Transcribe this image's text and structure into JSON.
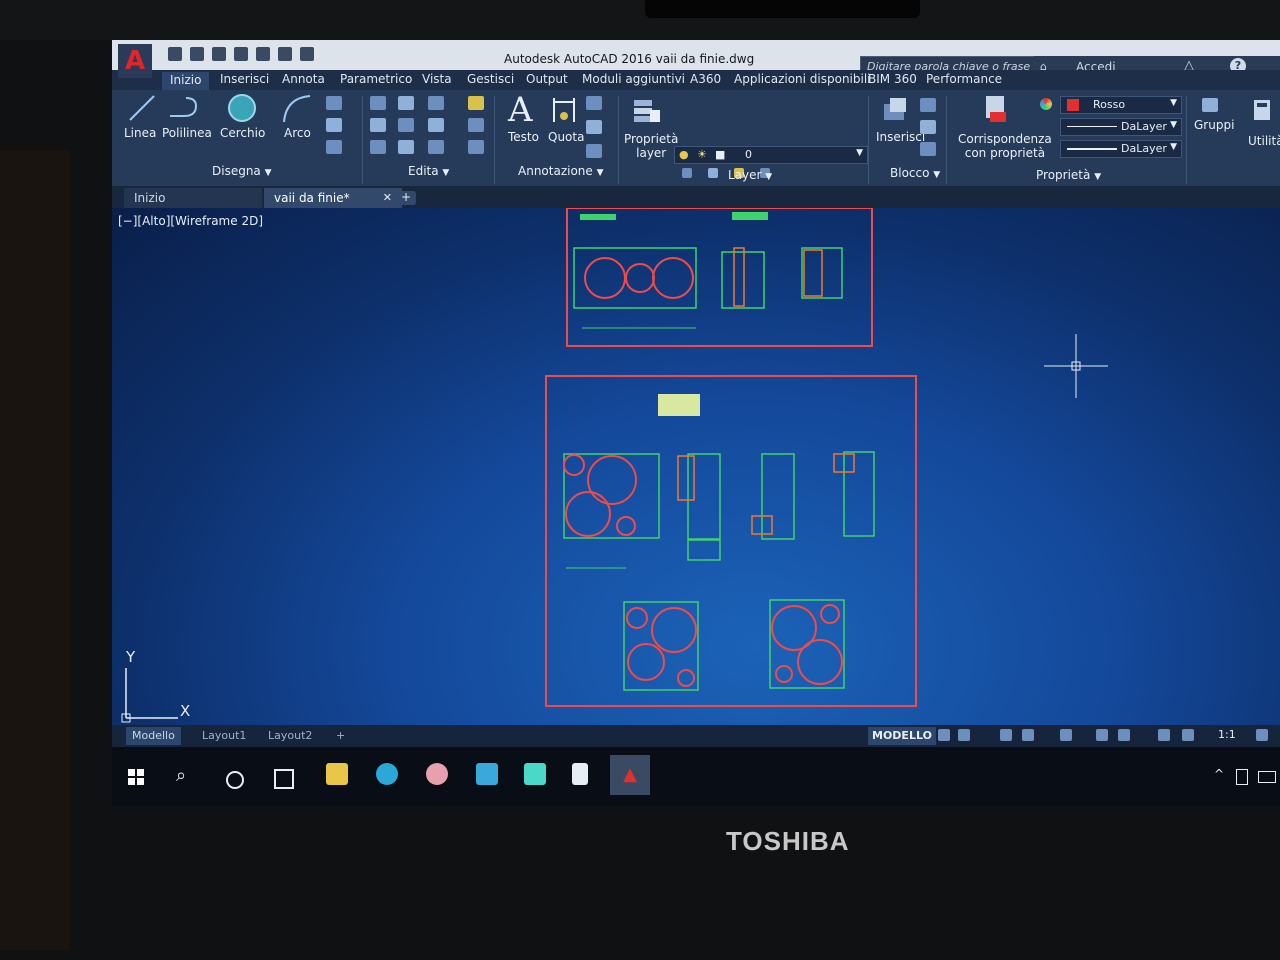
{
  "app": {
    "title": "Autodesk AutoCAD 2016    vaii da finie.dwg",
    "logo": "A"
  },
  "search": {
    "placeholder": "Digitare parola chiave o frase"
  },
  "account": {
    "login_label": "Accedi",
    "help": "?"
  },
  "ribbon_tabs": [
    {
      "label": "Inizio"
    },
    {
      "label": "Inserisci"
    },
    {
      "label": "Annota"
    },
    {
      "label": "Parametrico"
    },
    {
      "label": "Vista"
    },
    {
      "label": "Gestisci"
    },
    {
      "label": "Output"
    },
    {
      "label": "Moduli aggiuntivi"
    },
    {
      "label": "A360"
    },
    {
      "label": "Applicazioni disponibili"
    },
    {
      "label": "BIM 360"
    },
    {
      "label": "Performance"
    }
  ],
  "ribbon": {
    "draw": {
      "linea": "Linea",
      "polilinea": "Polilinea",
      "cerchio": "Cerchio",
      "arco": "Arco",
      "title": "Disegna"
    },
    "edit": {
      "title": "Edita"
    },
    "annotation": {
      "testo": "Testo",
      "quota": "Quota",
      "title": "Annotazione"
    },
    "layer": {
      "proprieta": "Proprietà",
      "layer": "layer",
      "current": "0",
      "title": "Layer"
    },
    "block": {
      "inserisci": "Inserisci",
      "title": "Blocco"
    },
    "properties": {
      "corrispondenza": "Corrispondenza",
      "con_proprieta": "con proprietà",
      "color": "Rosso",
      "linetype": "DaLayer",
      "lineweight": "DaLayer",
      "title": "Proprietà"
    },
    "groups": {
      "label": "Gruppi"
    },
    "utilities": {
      "label": "Utilità"
    }
  },
  "document_tabs": [
    {
      "label": "Inizio"
    },
    {
      "label": "vaii da finie*"
    }
  ],
  "viewport_label": "[−][Alto][Wireframe 2D]",
  "ucs": {
    "x": "X",
    "y": "Y"
  },
  "layout_tabs": [
    {
      "label": "Modello"
    },
    {
      "label": "Layout1"
    },
    {
      "label": "Layout2"
    }
  ],
  "status": {
    "mode": "MODELLO",
    "scale": "1:1"
  },
  "laptop_brand": "TOSHIBA",
  "colors": {
    "accent_red": "#e3302f",
    "drawing_green": "#3fd36b",
    "drawing_orange": "#f07830",
    "canvas_blue": "#14489a"
  }
}
